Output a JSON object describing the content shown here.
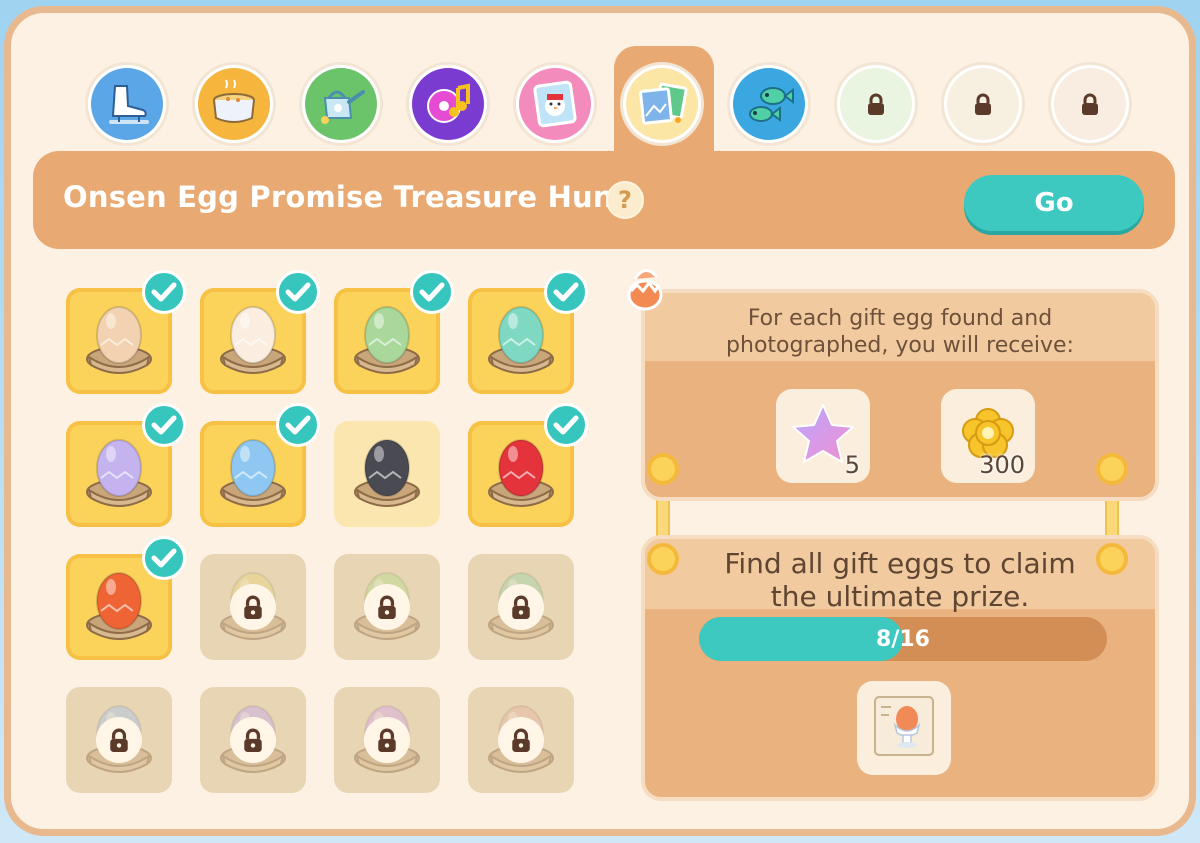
{
  "header": {
    "title": "Onsen Egg Promise Treasure Hunt",
    "help_label": "?",
    "go_label": "Go"
  },
  "tabs": [
    {
      "name": "ice-skate",
      "locked": false
    },
    {
      "name": "soup-pot",
      "locked": false
    },
    {
      "name": "watering-can",
      "locked": false
    },
    {
      "name": "music-disc",
      "locked": false
    },
    {
      "name": "snowman-card",
      "locked": false
    },
    {
      "name": "photo-album",
      "locked": false,
      "active": true
    },
    {
      "name": "fish",
      "locked": false
    },
    {
      "name": "locked-1",
      "locked": true
    },
    {
      "name": "locked-2",
      "locked": true
    },
    {
      "name": "locked-3",
      "locked": true
    }
  ],
  "eggs": [
    {
      "color": "#f2d2b0",
      "state": "found"
    },
    {
      "color": "#fbeee0",
      "state": "found"
    },
    {
      "color": "#a9d89a",
      "state": "found"
    },
    {
      "color": "#7fd9c2",
      "state": "found"
    },
    {
      "color": "#c4b3ef",
      "state": "found"
    },
    {
      "color": "#8ec8f2",
      "state": "found"
    },
    {
      "color": "#4a4a52",
      "state": "seen"
    },
    {
      "color": "#e5333c",
      "state": "found"
    },
    {
      "color": "#ef6434",
      "state": "found"
    },
    {
      "color": "#e6d67e",
      "state": "locked"
    },
    {
      "color": "#b9dc8c",
      "state": "locked"
    },
    {
      "color": "#9fd6a6",
      "state": "locked"
    },
    {
      "color": "#a8c5ea",
      "state": "locked"
    },
    {
      "color": "#c2a9ec",
      "state": "locked"
    },
    {
      "color": "#d7a8e8",
      "state": "locked"
    },
    {
      "color": "#e8b5a2",
      "state": "locked"
    }
  ],
  "reward": {
    "text_line1": "For each gift egg found and",
    "text_line2": "photographed, you will receive:",
    "items": [
      {
        "icon": "purple-star-icon",
        "count": "5"
      },
      {
        "icon": "gold-coin-icon",
        "count": "300"
      }
    ]
  },
  "prize": {
    "text_line1": "Find all gift eggs to claim",
    "text_line2": "the ultimate prize.",
    "progress_text": "8/16",
    "progress_fraction": 0.5,
    "icon": "egg-cup-recipe-icon"
  },
  "colors": {
    "accent": "#3dc9c0",
    "panel_orange": "#e8aa72",
    "cream": "#fdf1e3"
  }
}
